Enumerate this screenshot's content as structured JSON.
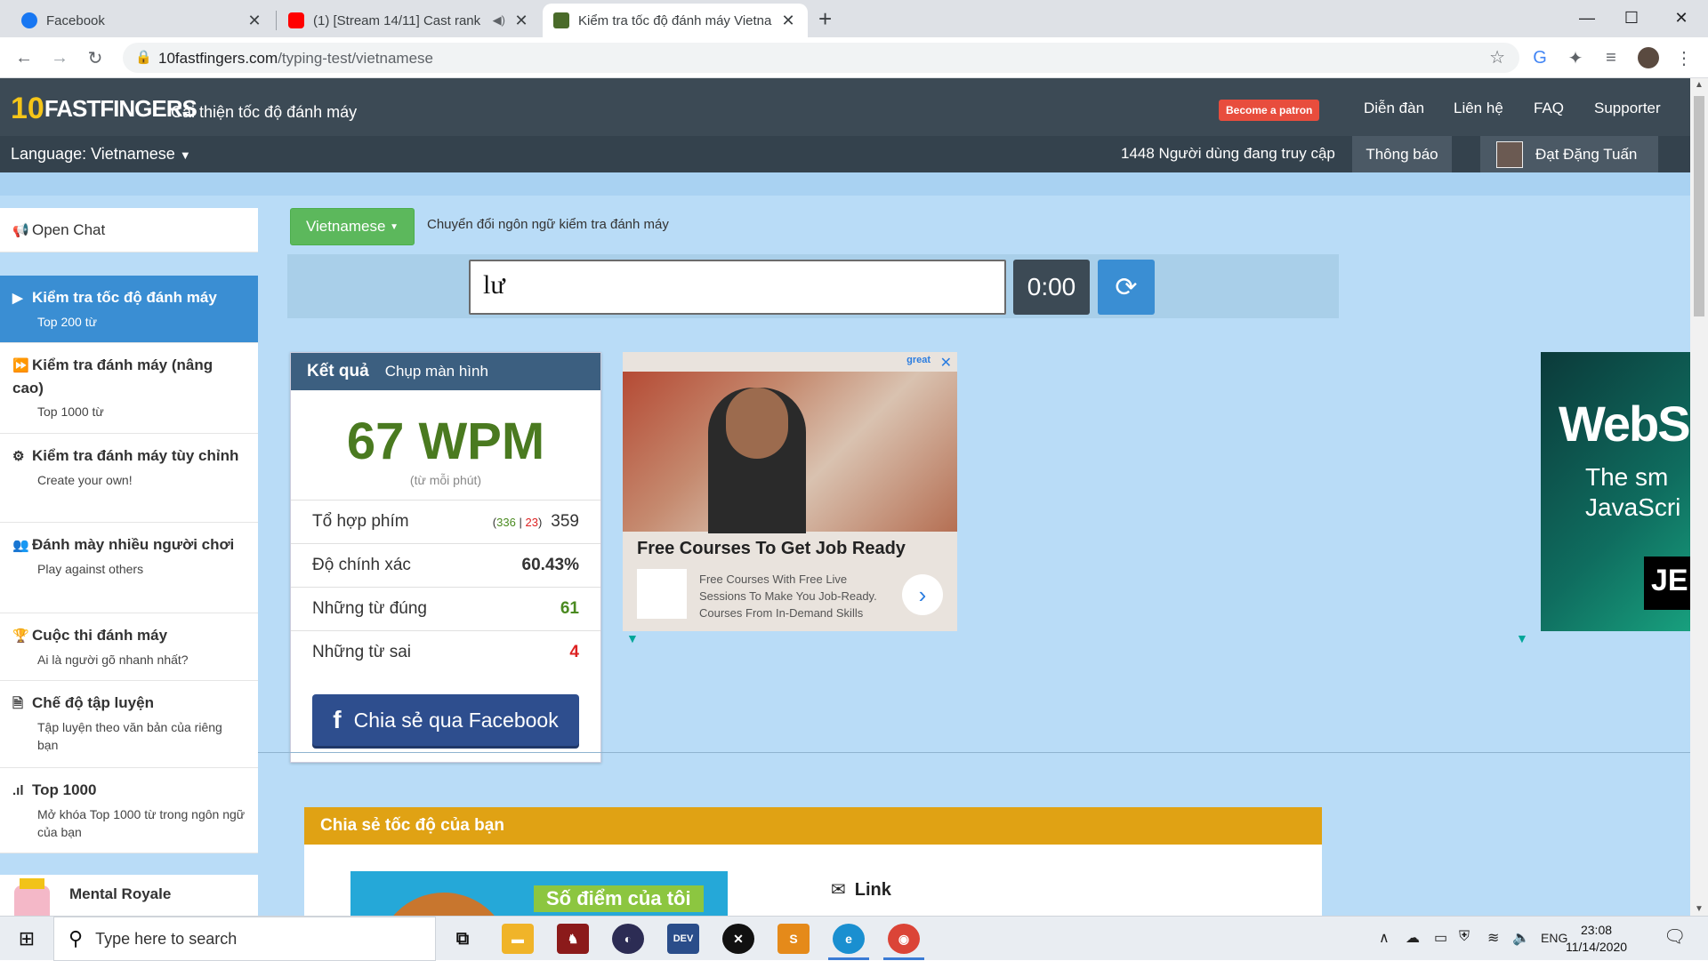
{
  "browser": {
    "tabs": [
      {
        "title": "Facebook",
        "icon": "facebook-icon",
        "color": "#1877f2"
      },
      {
        "title": "(1) [Stream 14/11] Cast rank",
        "icon": "youtube-icon",
        "color": "#ff0000"
      },
      {
        "title": "Kiểm tra tốc độ đánh máy Vietna",
        "icon": "10ff-icon",
        "color": "#4a6b2a"
      }
    ],
    "url_host": "10fastfingers.com",
    "url_path": "/typing-test/vietnamese"
  },
  "site": {
    "logo_ten": "10",
    "logo_name": "FASTFINGERS",
    "tagline": "Cải thiện tốc độ đánh máy",
    "patron": "Become a patron",
    "nav": [
      "Diễn đàn",
      "Liên hệ",
      "FAQ",
      "Supporter"
    ],
    "language_selector": "Language: Vietnamese",
    "online_count": "1448 Người dùng đang truy cập",
    "notifications": "Thông báo",
    "username": "Đạt Đặng Tuấn"
  },
  "sidebar": {
    "open_chat": "Open Chat",
    "items": [
      {
        "title": "Kiểm tra tốc độ đánh máy",
        "sub": "Top 200 từ"
      },
      {
        "title": "Kiểm tra đánh máy (nâng cao)",
        "sub": "Top 1000 từ"
      },
      {
        "title": "Kiểm tra đánh máy tùy chỉnh",
        "sub": "Create your own!"
      },
      {
        "title": "Đánh mày nhiều người chơi",
        "sub": "Play against others"
      },
      {
        "title": "Cuộc thi đánh máy",
        "sub": "Ai là người gõ nhanh nhất?"
      },
      {
        "title": "Chế độ tập luyện",
        "sub": "Tập luyện theo văn bản của riêng bạn"
      },
      {
        "title": "Top 1000",
        "sub": "Mở khóa Top 1000 từ trong ngôn ngữ của bạn"
      }
    ],
    "mental": "Mental Royale"
  },
  "test": {
    "language_button": "Vietnamese",
    "language_hint": "Chuyển đổi ngôn ngữ kiểm tra đánh máy",
    "input_value": "lư",
    "timer": "0:00"
  },
  "results": {
    "header": "Kết quả",
    "screenshot": "Chụp màn hình",
    "wpm": "67 WPM",
    "wpm_sub": "(từ mỗi phút)",
    "keystrokes_label": "Tổ hợp phím",
    "keystrokes_correct": "336",
    "keystrokes_sep": "|",
    "keystrokes_wrong": "23",
    "keystrokes_total": "359",
    "accuracy_label": "Độ chính xác",
    "accuracy": "60.43%",
    "correct_words_label": "Những từ đúng",
    "correct_words": "61",
    "wrong_words_label": "Những từ sai",
    "wrong_words": "4",
    "facebook_share": "Chia sẻ qua Facebook"
  },
  "ads": {
    "ad1_title": "Free Courses To Get Job Ready",
    "ad1_desc": "Free Courses With Free Live Sessions To Make You Job-Ready. Courses From In-Demand Skills",
    "ad1_brand": "great",
    "ad2_big": "WebS",
    "ad2_line1": "The sm",
    "ad2_line2": "JavaScri",
    "ad2_logo": "JE"
  },
  "share": {
    "header": "Chia sẻ tốc độ của bạn",
    "banner_label": "Số điểm của tôi",
    "link_label": "Link"
  },
  "taskbar": {
    "search_placeholder": "Type here to search",
    "lang": "ENG",
    "time": "23:08",
    "date": "11/14/2020"
  }
}
